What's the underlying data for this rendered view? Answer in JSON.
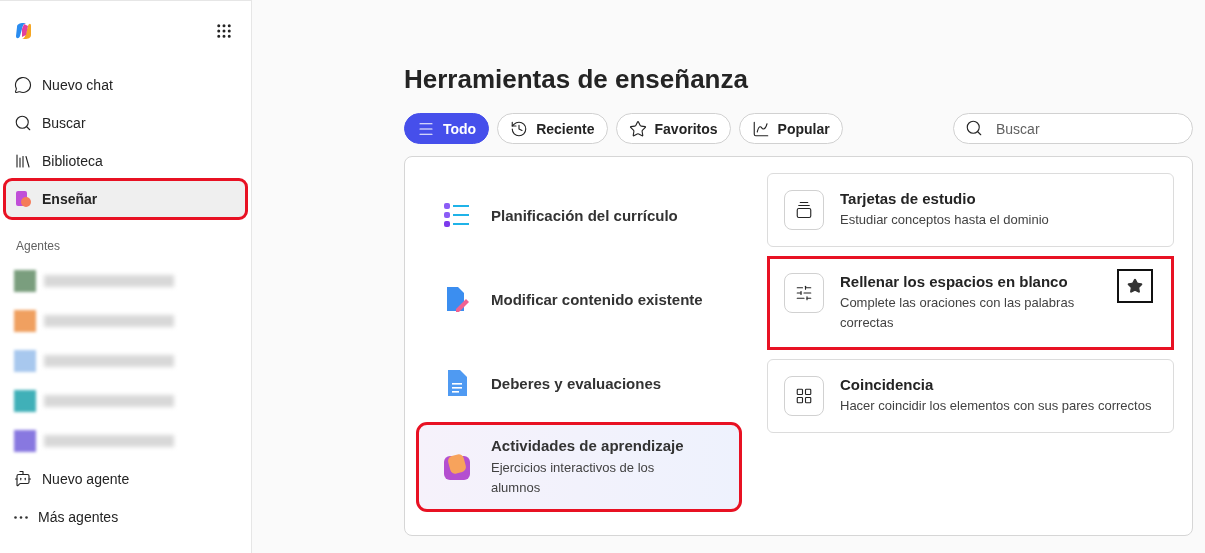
{
  "sidebar": {
    "nav": [
      {
        "label": "Nuevo chat",
        "kind": "chat",
        "selected": false,
        "highlighted": false
      },
      {
        "label": "Buscar",
        "kind": "search",
        "selected": false,
        "highlighted": false
      },
      {
        "label": "Biblioteca",
        "kind": "library",
        "selected": false,
        "highlighted": false
      },
      {
        "label": "Enseñar",
        "kind": "teach",
        "selected": true,
        "highlighted": true
      }
    ],
    "agents_heading": "Agentes",
    "agents": [
      {
        "color": "#7a9e7e"
      },
      {
        "color": "#f0a060"
      },
      {
        "color": "#a8c8ee"
      },
      {
        "color": "#40b0b8"
      },
      {
        "color": "#8878e0"
      }
    ],
    "agent_actions": [
      {
        "label": "Nuevo agente",
        "kind": "new-agent"
      },
      {
        "label": "Más agentes",
        "kind": "more"
      }
    ]
  },
  "main": {
    "title": "Herramientas de enseñanza",
    "filters": [
      {
        "label": "Todo",
        "kind": "lines",
        "selected": true
      },
      {
        "label": "Reciente",
        "kind": "history",
        "selected": false
      },
      {
        "label": "Favoritos",
        "kind": "star",
        "selected": false
      },
      {
        "label": "Popular",
        "kind": "trend",
        "selected": false
      }
    ],
    "search": {
      "placeholder": "Buscar"
    },
    "categories": [
      {
        "label": "Planificación del currículo",
        "kind": "list",
        "selected": false,
        "highlighted": false
      },
      {
        "label": "Modificar contenido existente",
        "kind": "edit-doc",
        "selected": false,
        "highlighted": false
      },
      {
        "label": "Deberes y evaluaciones",
        "kind": "doc",
        "selected": false,
        "highlighted": false
      },
      {
        "label": "Actividades de aprendizaje",
        "description": "Ejercicios interactivos de los alumnos",
        "kind": "activity",
        "selected": true,
        "highlighted": true
      }
    ],
    "tools": [
      {
        "title": "Tarjetas de estudio",
        "description": "Estudiar conceptos hasta el dominio",
        "kind": "cards",
        "highlighted": false,
        "favorite_button": false
      },
      {
        "title": "Rellenar los espacios en blanco",
        "description": "Complete las oraciones con las palabras correctas",
        "kind": "sliders",
        "highlighted": true,
        "favorite_button": true
      },
      {
        "title": "Coincidencia",
        "description": "Hacer coincidir los elementos con sus pares correctos",
        "kind": "grid",
        "highlighted": false,
        "favorite_button": false
      }
    ]
  }
}
